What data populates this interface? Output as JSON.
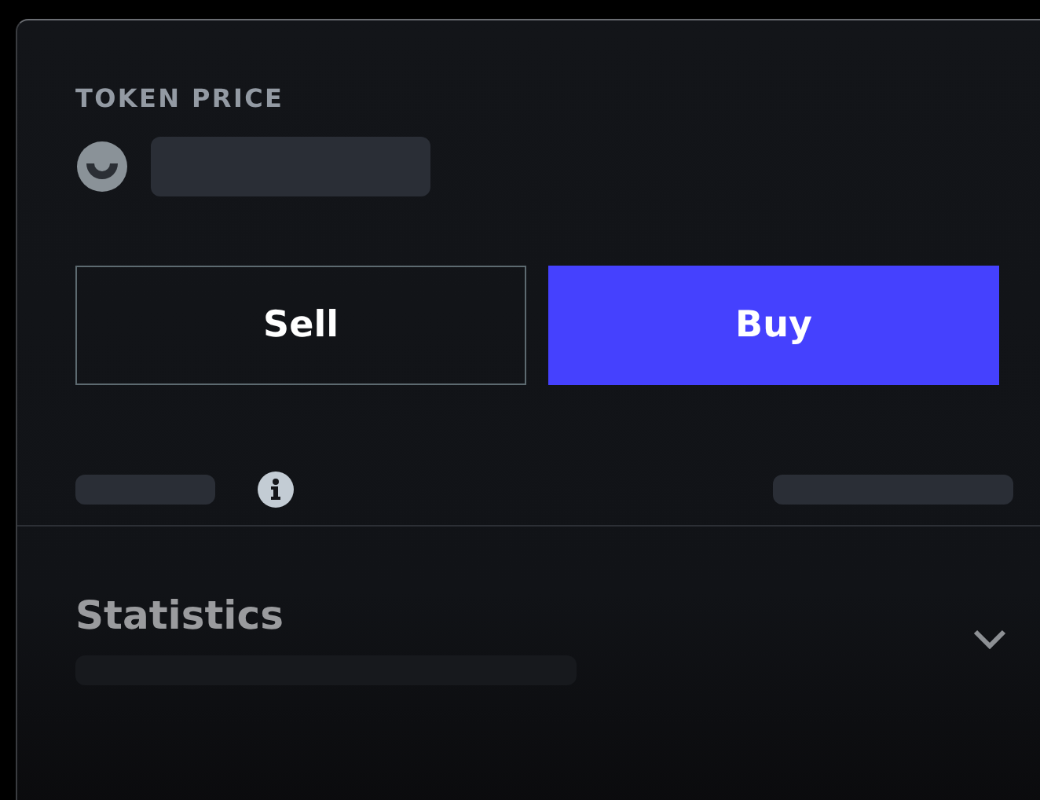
{
  "price_section": {
    "label": "TOKEN PRICE"
  },
  "actions": [
    {
      "label": "Sell",
      "kind": "outline"
    },
    {
      "label": "Buy",
      "kind": "primary"
    }
  ],
  "statistics": {
    "title": "Statistics",
    "expanded": false
  }
}
